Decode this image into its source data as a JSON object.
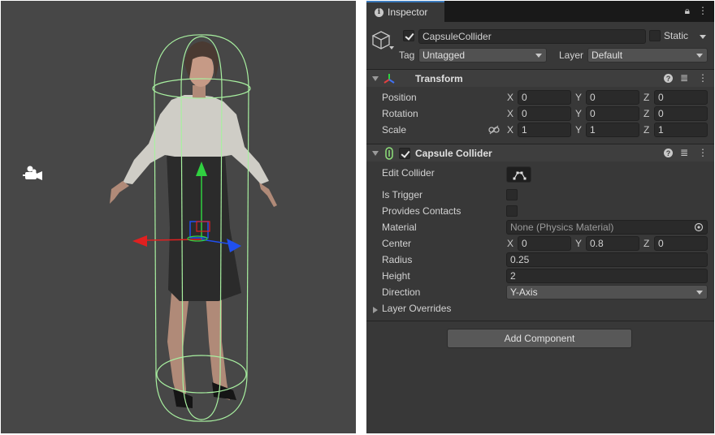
{
  "inspector": {
    "tab_label": "Inspector",
    "lock_icon": "lock-icon",
    "menu_icon": "kebab-menu-icon",
    "gameobject": {
      "active": true,
      "name": "CapsuleCollider",
      "static_label": "Static",
      "static_checked": false,
      "tag_label": "Tag",
      "tag_value": "Untagged",
      "layer_label": "Layer",
      "layer_value": "Default"
    },
    "transform": {
      "title": "Transform",
      "rows": [
        {
          "label": "Position",
          "x": "0",
          "y": "0",
          "z": "0"
        },
        {
          "label": "Rotation",
          "x": "0",
          "y": "0",
          "z": "0"
        },
        {
          "label": "Scale",
          "x": "1",
          "y": "1",
          "z": "1"
        }
      ],
      "axis_labels": [
        "X",
        "Y",
        "Z"
      ]
    },
    "capsule_collider": {
      "title": "Capsule Collider",
      "enabled": true,
      "edit_collider_label": "Edit Collider",
      "is_trigger_label": "Is Trigger",
      "is_trigger": false,
      "provides_contacts_label": "Provides Contacts",
      "provides_contacts": false,
      "material_label": "Material",
      "material_value": "None (Physics Material)",
      "center_label": "Center",
      "center": {
        "x": "0",
        "y": "0.8",
        "z": "0"
      },
      "radius_label": "Radius",
      "radius_value": "0.25",
      "height_label": "Height",
      "height_value": "2",
      "direction_label": "Direction",
      "direction_value": "Y-Axis",
      "layer_overrides_label": "Layer Overrides"
    },
    "add_component_label": "Add Component"
  },
  "colors": {
    "accent_tab": "#3a79bb",
    "collider_gizmo": "#a8f0a0",
    "gizmo_x": "#e02020",
    "gizmo_y": "#30d040",
    "gizmo_z": "#2050f0"
  }
}
